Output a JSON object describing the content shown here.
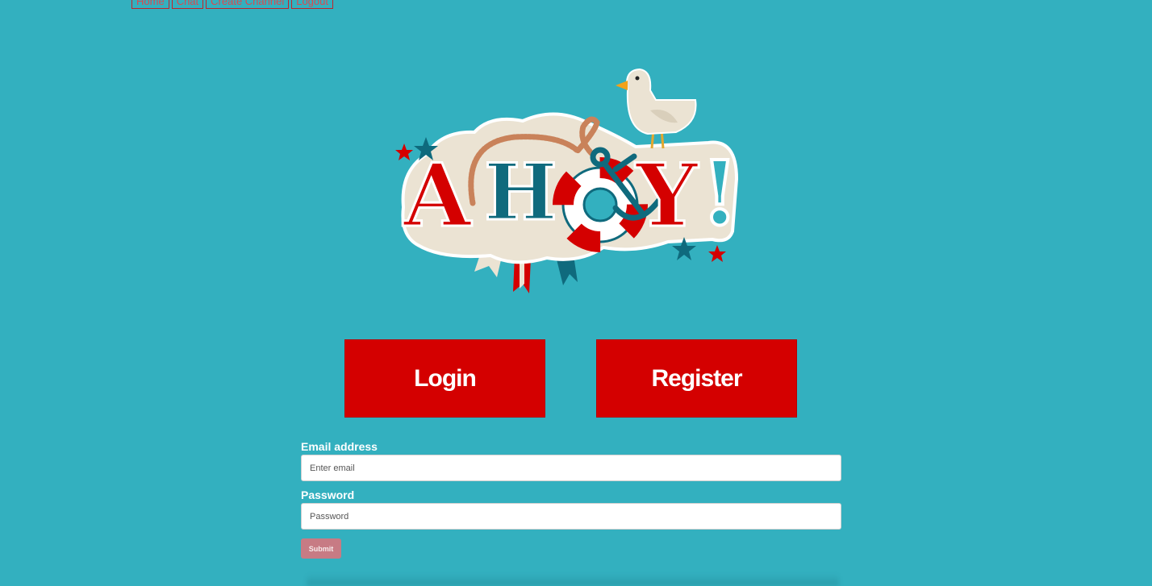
{
  "nav": {
    "items": [
      "Home",
      "Chat",
      "Create Channel",
      "Logout"
    ]
  },
  "logo": {
    "text": "AHOY!",
    "icons": [
      "seagull-icon",
      "anchor-icon",
      "lifebuoy-icon",
      "rope-icon",
      "star-icon",
      "ribbon-icon"
    ]
  },
  "buttons": {
    "login": "Login",
    "register": "Register"
  },
  "form": {
    "email_label": "Email address",
    "email_placeholder": "Enter email",
    "password_label": "Password",
    "password_placeholder": "Password",
    "submit": "Submit"
  },
  "colors": {
    "background": "#33b0bf",
    "primary_red": "#d40000",
    "teal_dark": "#0f6a7d",
    "submit_bg": "#c77b84"
  }
}
